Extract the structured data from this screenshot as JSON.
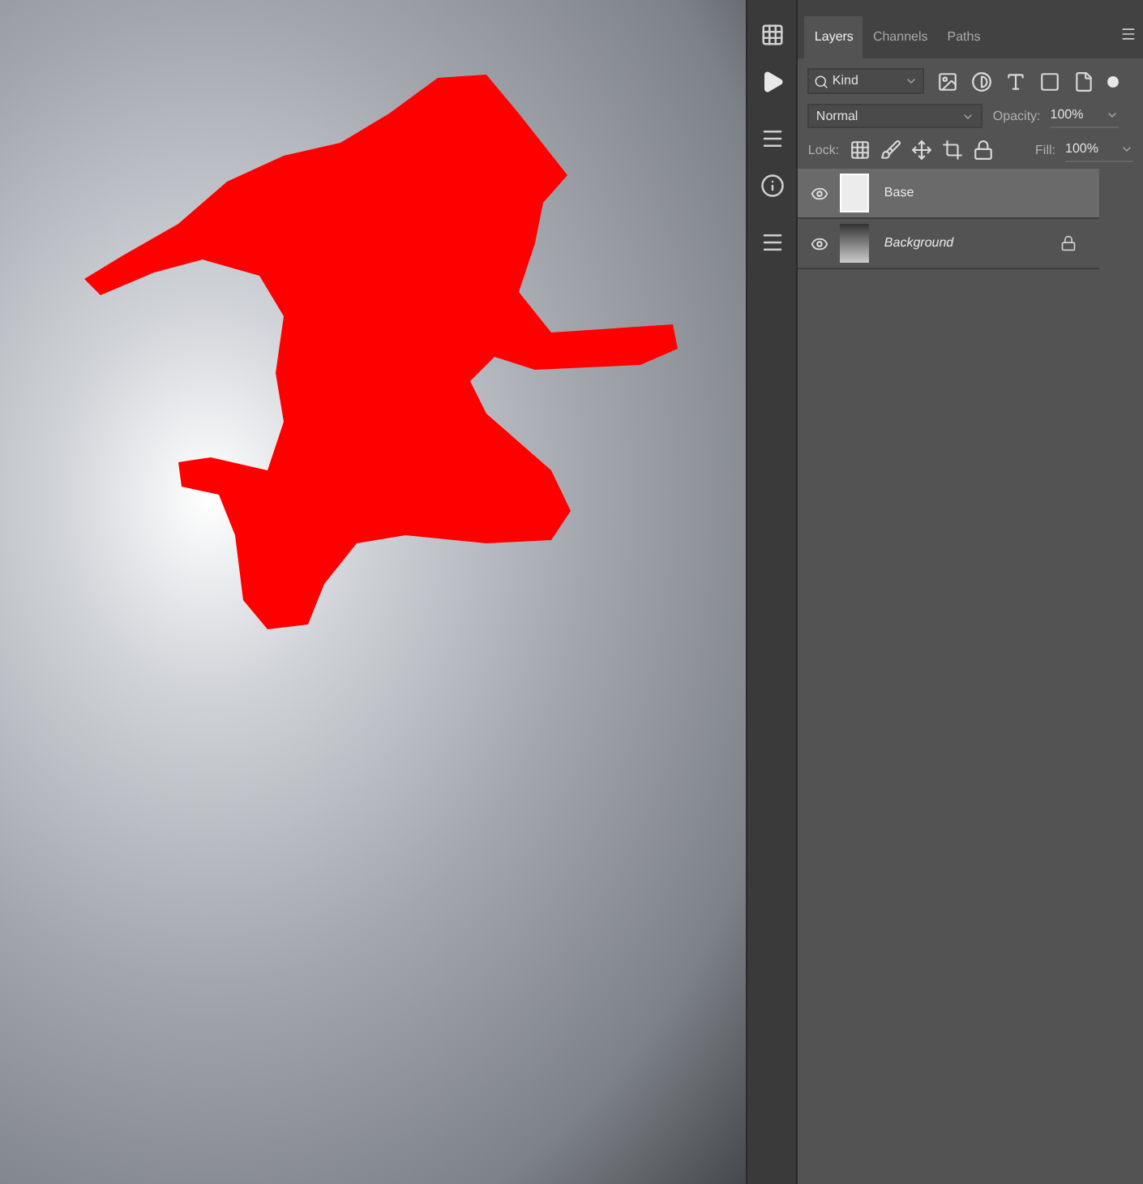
{
  "tabs": [
    {
      "label": "Layers",
      "selected": true
    },
    {
      "label": "Channels",
      "selected": false
    },
    {
      "label": "Paths",
      "selected": false
    }
  ],
  "filter": {
    "value": "Kind"
  },
  "blend_mode": {
    "value": "Normal"
  },
  "opacity": {
    "label": "Opacity:",
    "value": "100%"
  },
  "lock": {
    "label": "Lock:"
  },
  "fill": {
    "label": "Fill:",
    "value": "100%"
  },
  "layers": [
    {
      "name": "Base",
      "kind": "normal",
      "selected": true,
      "visible": true,
      "locked": false
    },
    {
      "name": "Background",
      "kind": "background",
      "selected": false,
      "visible": true,
      "locked": true
    }
  ]
}
